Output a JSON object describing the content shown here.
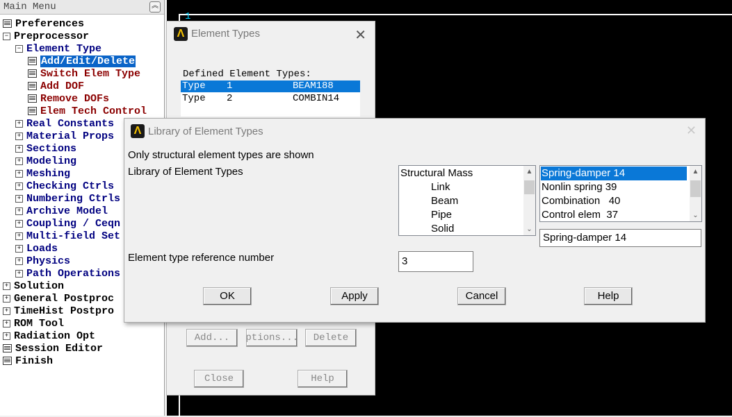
{
  "main_menu": {
    "title": "Main Menu",
    "items": [
      {
        "label": "Preferences",
        "kind": "leaf"
      },
      {
        "label": "Preprocessor",
        "kind": "collapse"
      },
      {
        "label": "Element Type",
        "kind": "collapse"
      },
      {
        "label": "Add/Edit/Delete",
        "kind": "leaf"
      },
      {
        "label": "Switch Elem Type",
        "kind": "leaf"
      },
      {
        "label": "Add DOF",
        "kind": "leaf"
      },
      {
        "label": "Remove DOFs",
        "kind": "leaf"
      },
      {
        "label": "Elem Tech Control",
        "kind": "leaf"
      },
      {
        "label": "Real Constants",
        "kind": "expand"
      },
      {
        "label": "Material Props",
        "kind": "expand"
      },
      {
        "label": "Sections",
        "kind": "expand"
      },
      {
        "label": "Modeling",
        "kind": "expand"
      },
      {
        "label": "Meshing",
        "kind": "expand"
      },
      {
        "label": "Checking Ctrls",
        "kind": "expand"
      },
      {
        "label": "Numbering Ctrls",
        "kind": "expand"
      },
      {
        "label": "Archive Model",
        "kind": "expand"
      },
      {
        "label": "Coupling / Ceqn",
        "kind": "expand"
      },
      {
        "label": "Multi-field Set Up",
        "kind": "expand"
      },
      {
        "label": "Loads",
        "kind": "expand"
      },
      {
        "label": "Physics",
        "kind": "expand"
      },
      {
        "label": "Path Operations",
        "kind": "expand"
      },
      {
        "label": "Solution",
        "kind": "expand"
      },
      {
        "label": "General Postproc",
        "kind": "expand"
      },
      {
        "label": "TimeHist Postpro",
        "kind": "expand"
      },
      {
        "label": "ROM Tool",
        "kind": "expand"
      },
      {
        "label": "Radiation Opt",
        "kind": "expand"
      },
      {
        "label": "Session Editor",
        "kind": "leaf"
      },
      {
        "label": "Finish",
        "kind": "leaf"
      }
    ]
  },
  "graphics": {
    "window_number": "1"
  },
  "element_types_window": {
    "title": "Element Types",
    "defined_label": "Defined Element Types:",
    "rows": [
      {
        "type": "Type",
        "num": "1",
        "name": "BEAM188"
      },
      {
        "type": "Type",
        "num": "2",
        "name": "COMBIN14"
      }
    ],
    "buttons": {
      "add": "Add...",
      "options": "Options...",
      "delete": "Delete",
      "close": "Close",
      "help": "Help"
    }
  },
  "library_dialog": {
    "title": "Library of Element Types",
    "note": "Only structural element types are shown",
    "library_label": "Library of Element Types",
    "categories": [
      "Structural Mass",
      "Link",
      "Beam",
      "Pipe",
      "Solid"
    ],
    "element_list": [
      "Spring-damper 14",
      "Nonlin spring 39",
      "Combination   40",
      "Control elem  37"
    ],
    "selected_element": "Spring-damper 14",
    "ref_number_label": "Element type reference number",
    "ref_number_value": "3",
    "buttons": {
      "ok": "OK",
      "apply": "Apply",
      "cancel": "Cancel",
      "help": "Help"
    }
  },
  "colors": {
    "selection": "#0a78d7",
    "graphics_bg": "#000000",
    "menu_blue": "#000080",
    "menu_red": "#8b0000"
  }
}
